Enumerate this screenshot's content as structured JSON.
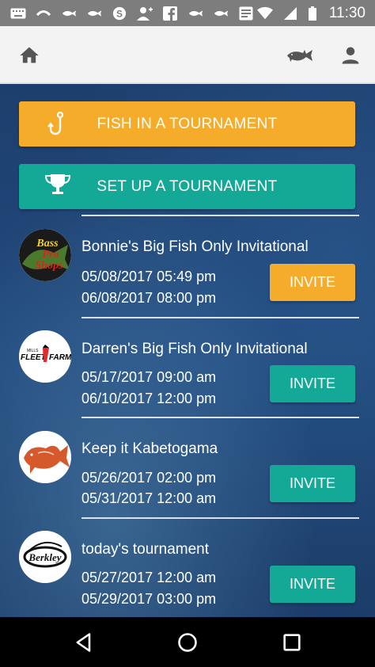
{
  "status_bar": {
    "time": "11:30",
    "icons_left": [
      "keyboard-icon",
      "carrier-icon",
      "fish-notification-icon",
      "fish-notification-icon",
      "skype-icon",
      "add-person-icon",
      "facebook-icon",
      "fish-notification-icon",
      "fish-notification-icon",
      "news-icon"
    ],
    "icons_right": [
      "wifi-icon",
      "signal-icon",
      "battery-icon"
    ]
  },
  "app_bar": {
    "icons": [
      "home-icon",
      "fish-icon",
      "profile-icon"
    ]
  },
  "actions": {
    "fish_label": "FISH IN A TOURNAMENT",
    "fish_icon": "hook-icon",
    "fish_color": "#f6ac2b",
    "setup_label": "SET UP A TOURNAMENT",
    "setup_icon": "trophy-icon",
    "setup_color": "#14a997"
  },
  "tournaments": [
    {
      "name": "Bonnie's Big Fish Only Invitational",
      "start": "05/08/2017 05:49 pm",
      "end": "06/08/2017 08:00 pm",
      "invite_label": "INVITE",
      "invite_color": "#f6ac2b",
      "logo_text": [
        "Bass",
        "Pro",
        "Shops"
      ]
    },
    {
      "name": "Darren's Big Fish Only Invitational",
      "start": "05/17/2017 09:00 am",
      "end": "06/10/2017 12:00 pm",
      "invite_label": "INVITE",
      "invite_color": "#14a997",
      "logo_text": [
        "MILLS",
        "FLEET",
        "FARM"
      ]
    },
    {
      "name": "Keep it Kabetogama",
      "start": "05/26/2017 02:00 pm",
      "end": "05/31/2017 12:00 am",
      "invite_label": "INVITE",
      "invite_color": "#14a997",
      "logo_text": []
    },
    {
      "name": "today's tournament",
      "start": "05/27/2017 12:00 am",
      "end": "05/29/2017 03:00 pm",
      "invite_label": "INVITE",
      "invite_color": "#14a997",
      "logo_text": [
        "Berkley"
      ]
    }
  ],
  "nav_bar": {
    "icons": [
      "back-icon",
      "home-circle-icon",
      "recents-icon"
    ]
  }
}
